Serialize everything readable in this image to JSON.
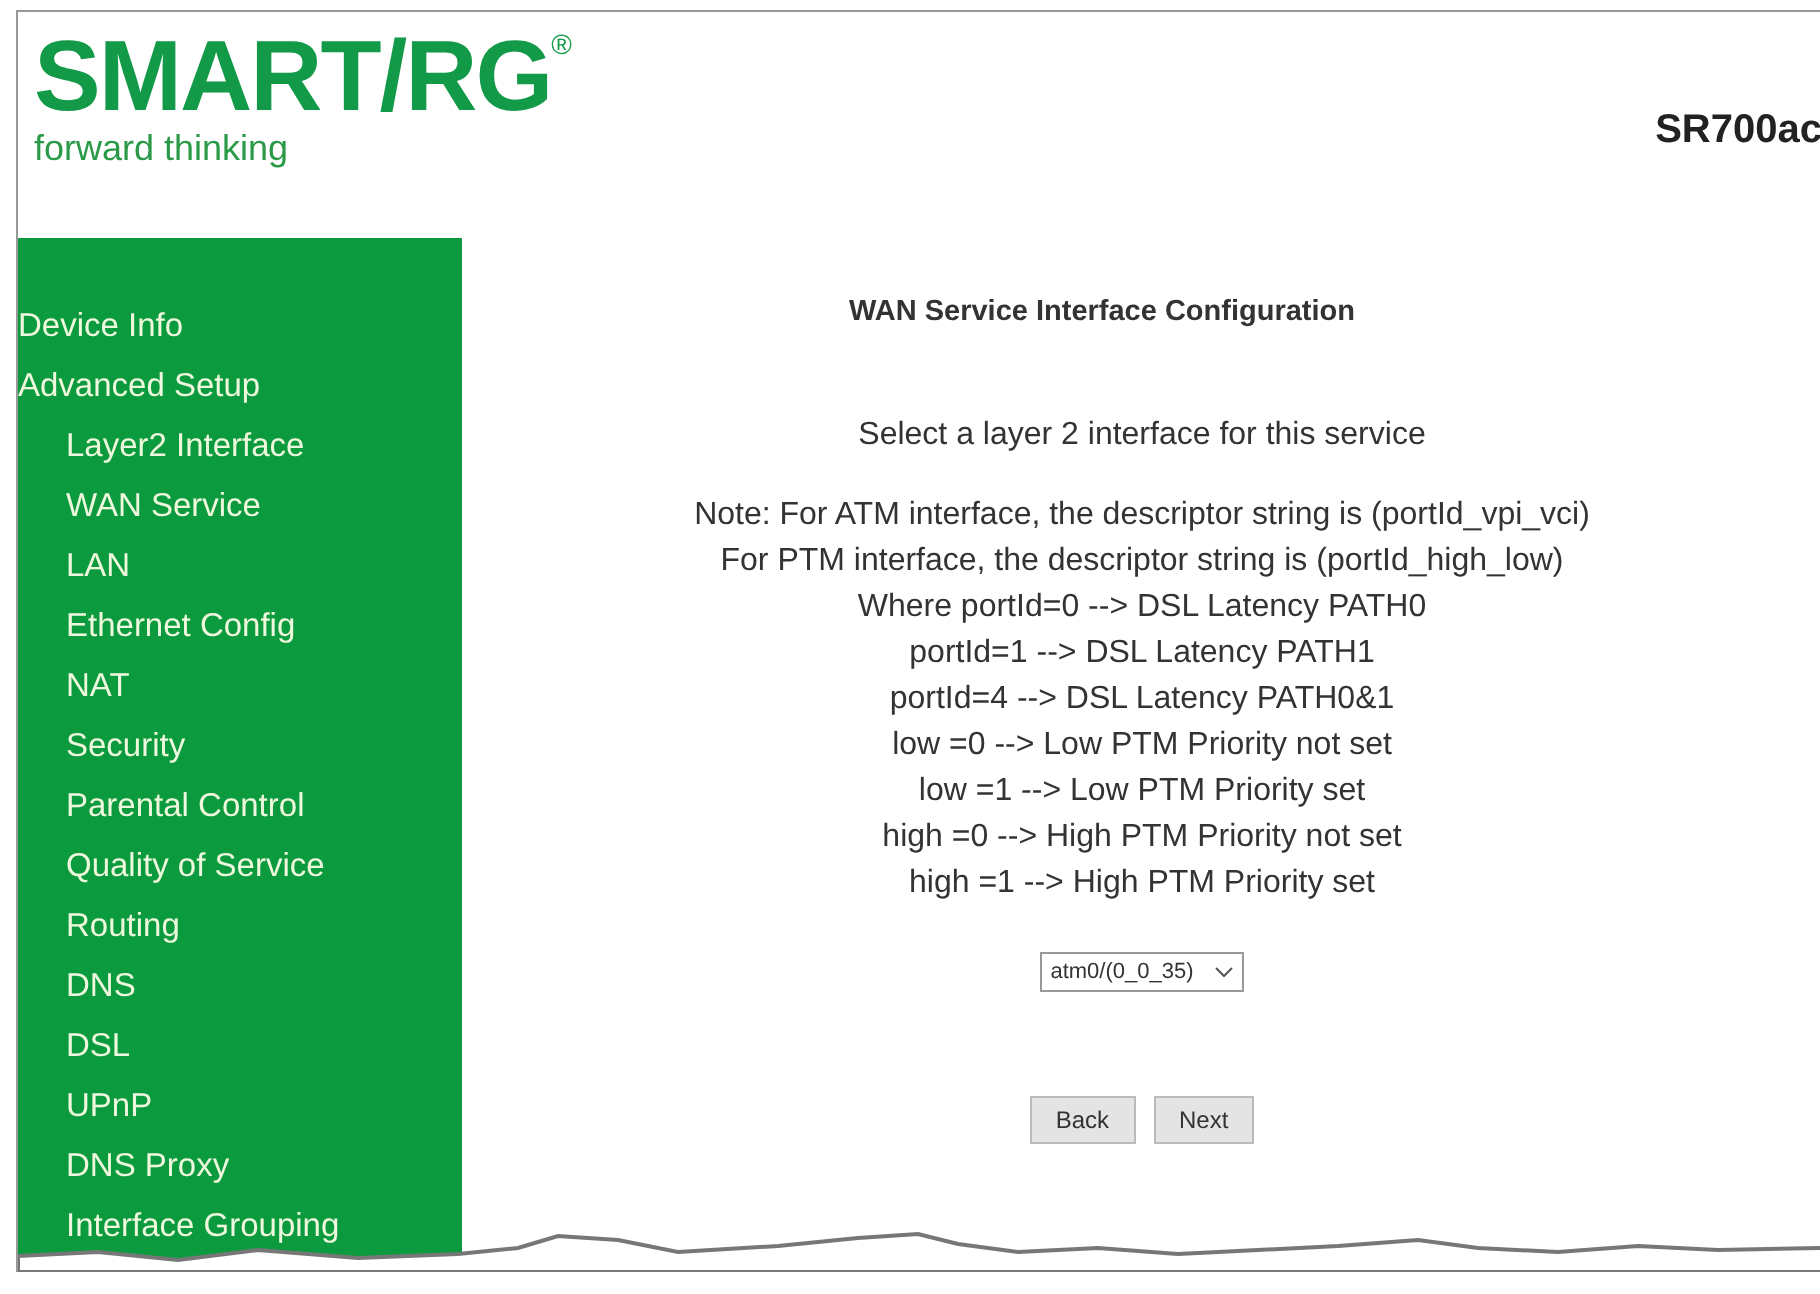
{
  "header": {
    "logo": "SMART/RG",
    "logo_mark": "®",
    "tagline": "forward thinking",
    "model": "SR700ac"
  },
  "sidebar": {
    "items": [
      {
        "label": "Device Info"
      },
      {
        "label": "Advanced Setup",
        "children": [
          {
            "label": "Layer2 Interface"
          },
          {
            "label": "WAN Service"
          },
          {
            "label": "LAN"
          },
          {
            "label": "Ethernet Config"
          },
          {
            "label": "NAT"
          },
          {
            "label": "Security"
          },
          {
            "label": "Parental Control"
          },
          {
            "label": "Quality of Service"
          },
          {
            "label": "Routing"
          },
          {
            "label": "DNS"
          },
          {
            "label": "DSL"
          },
          {
            "label": "UPnP"
          },
          {
            "label": "DNS Proxy"
          },
          {
            "label": "Interface Grouping"
          }
        ]
      }
    ]
  },
  "main": {
    "title": "WAN Service Interface Configuration",
    "prompt": "Select a layer 2 interface for this service",
    "notes": [
      "Note: For ATM interface, the descriptor string is (portId_vpi_vci)",
      "For PTM interface, the descriptor string is (portId_high_low)",
      "Where portId=0 --> DSL Latency PATH0",
      "portId=1 --> DSL Latency PATH1",
      "portId=4 --> DSL Latency PATH0&1",
      "low =0 --> Low PTM Priority not set",
      "low =1 --> Low PTM Priority set",
      "high =0 --> High PTM Priority not set",
      "high =1 --> High PTM Priority set"
    ],
    "interface_select": {
      "value": "atm0/(0_0_35)"
    },
    "buttons": [
      "Back",
      "Next"
    ]
  }
}
